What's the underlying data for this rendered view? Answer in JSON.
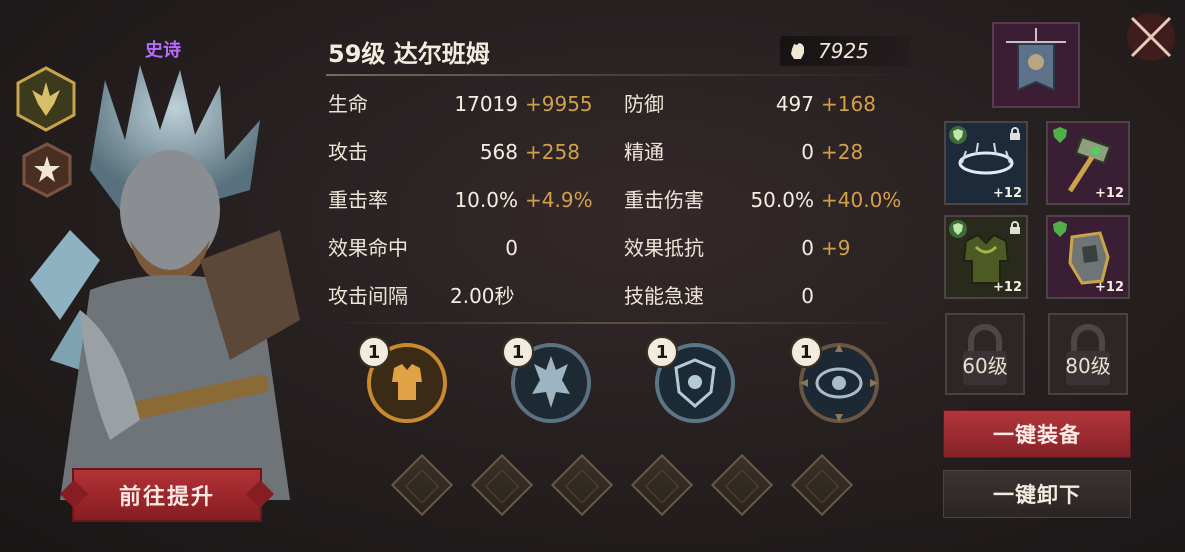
{
  "hero": {
    "rarity": "史诗",
    "name": "59级 达尔班姆",
    "power": "7925",
    "upgrade_button": "前往提升"
  },
  "stats": [
    {
      "label": "生命",
      "base": "17019",
      "bonus": "+9955"
    },
    {
      "label": "防御",
      "base": "497",
      "bonus": "+168"
    },
    {
      "label": "攻击",
      "base": "568",
      "bonus": "+258"
    },
    {
      "label": "精通",
      "base": "0",
      "bonus": "+28"
    },
    {
      "label": "重击率",
      "base": "10.0%",
      "bonus": "+4.9%"
    },
    {
      "label": "重击伤害",
      "base": "50.0%",
      "bonus": "+40.0%"
    },
    {
      "label": "效果命中",
      "base": "0",
      "bonus": ""
    },
    {
      "label": "效果抵抗",
      "base": "0",
      "bonus": "+9"
    },
    {
      "label": "攻击间隔",
      "base": "2.00秒",
      "bonus": ""
    },
    {
      "label": "技能急速",
      "base": "0",
      "bonus": ""
    }
  ],
  "skills": [
    {
      "level": "1",
      "icon": "armor-skill-icon"
    },
    {
      "level": "1",
      "icon": "crystal-skill-icon"
    },
    {
      "level": "1",
      "icon": "shield-skill-icon"
    },
    {
      "level": "1",
      "icon": "eye-skill-icon"
    }
  ],
  "equipment": [
    {
      "icon": "crystal-ring-icon",
      "level": "+12"
    },
    {
      "icon": "hammer-icon",
      "level": "+12"
    },
    {
      "icon": "leaf-armor-icon",
      "level": "+12"
    },
    {
      "icon": "gauntlet-icon",
      "level": "+12"
    }
  ],
  "locked_slots": [
    "60级",
    "80级"
  ],
  "buttons": {
    "equip_all": "一键装备",
    "unequip_all": "一键卸下"
  },
  "colors": {
    "rarity": "#b66bff",
    "bonus": "#d3a04a",
    "primary_button": "#b1363a"
  }
}
